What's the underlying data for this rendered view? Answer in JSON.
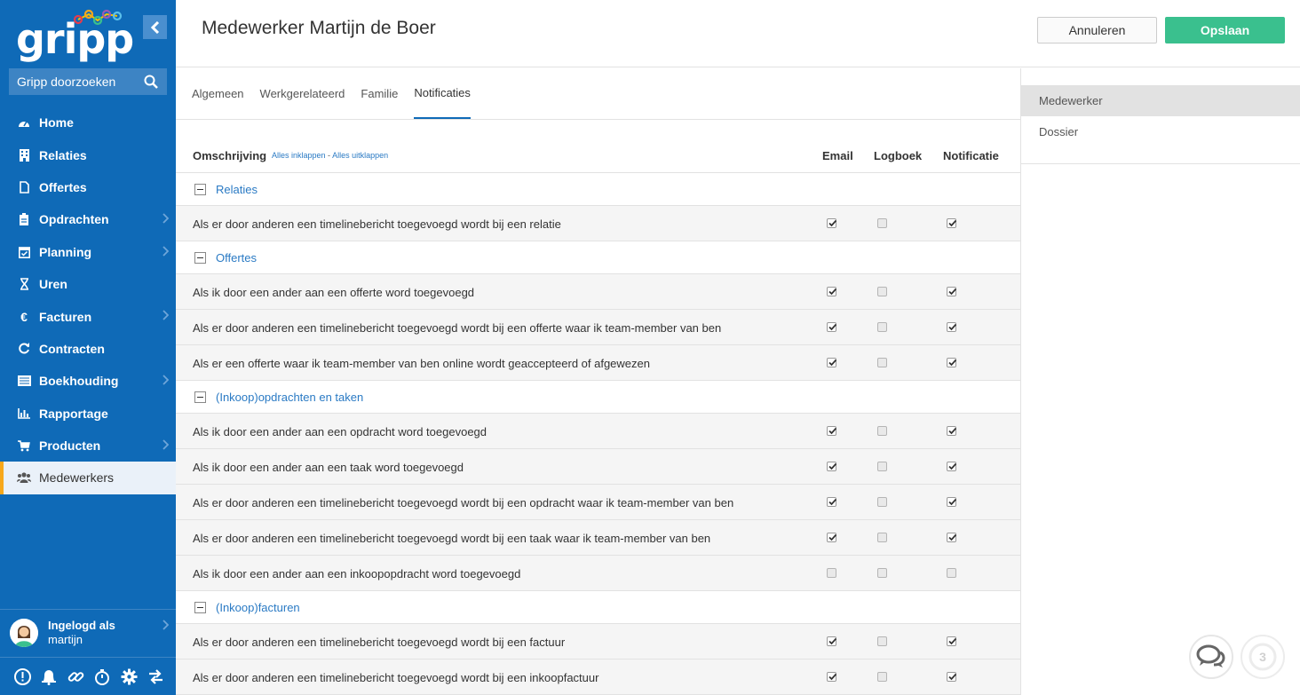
{
  "app": {
    "logo": "gripp"
  },
  "sidebar": {
    "search_placeholder": "Gripp doorzoeken",
    "items": [
      {
        "label": "Home",
        "icon": "dashboard-icon"
      },
      {
        "label": "Relaties",
        "icon": "building-icon"
      },
      {
        "label": "Offertes",
        "icon": "document-icon"
      },
      {
        "label": "Opdrachten",
        "icon": "clipboard-icon",
        "has_submenu": true
      },
      {
        "label": "Planning",
        "icon": "calendar-icon",
        "has_submenu": true
      },
      {
        "label": "Uren",
        "icon": "hourglass-icon"
      },
      {
        "label": "Facturen",
        "icon": "euro-icon",
        "has_submenu": true
      },
      {
        "label": "Contracten",
        "icon": "refresh-icon"
      },
      {
        "label": "Boekhouding",
        "icon": "ledger-icon",
        "has_submenu": true
      },
      {
        "label": "Rapportage",
        "icon": "bar-chart-icon"
      },
      {
        "label": "Producten",
        "icon": "cart-icon",
        "has_submenu": true
      },
      {
        "label": "Medewerkers",
        "icon": "users-icon",
        "active": true
      }
    ],
    "user": {
      "line1": "Ingelogd als",
      "line2": "martijn"
    },
    "bottom_icons": [
      "alert-icon",
      "bell-icon",
      "link-icon",
      "timer-icon",
      "gear-icon",
      "switch-icon"
    ]
  },
  "header": {
    "title": "Medewerker Martijn de Boer",
    "cancel_label": "Annuleren",
    "save_label": "Opslaan"
  },
  "tabs": [
    {
      "label": "Algemeen"
    },
    {
      "label": "Werkgerelateerd"
    },
    {
      "label": "Familie"
    },
    {
      "label": "Notificaties",
      "active": true
    }
  ],
  "right_panel": {
    "items": [
      {
        "label": "Medewerker",
        "active": true
      },
      {
        "label": "Dossier"
      }
    ]
  },
  "table": {
    "col_description": "Omschrijving",
    "collapse_all": "Alles inklappen",
    "separator": " - ",
    "expand_all": "Alles uitklappen",
    "col_email": "Email",
    "col_logbook": "Logboek",
    "col_notification": "Notificatie",
    "groups": [
      {
        "label": "Relaties",
        "rows": [
          {
            "label": "Als er door anderen een timelinebericht toegevoegd wordt bij een relatie",
            "email": true,
            "logbook": false,
            "notification": true
          }
        ]
      },
      {
        "label": "Offertes",
        "rows": [
          {
            "label": "Als ik door een ander aan een offerte word toegevoegd",
            "email": true,
            "logbook": false,
            "notification": true
          },
          {
            "label": "Als er door anderen een timelinebericht toegevoegd wordt bij een offerte waar ik team-member van ben",
            "email": true,
            "logbook": false,
            "notification": true
          },
          {
            "label": "Als er een offerte waar ik team-member van ben online wordt geaccepteerd of afgewezen",
            "email": true,
            "logbook": false,
            "notification": true
          }
        ]
      },
      {
        "label": "(Inkoop)opdrachten en taken",
        "rows": [
          {
            "label": "Als ik door een ander aan een opdracht word toegevoegd",
            "email": true,
            "logbook": false,
            "notification": true
          },
          {
            "label": "Als ik door een ander aan een taak word toegevoegd",
            "email": true,
            "logbook": false,
            "notification": true
          },
          {
            "label": "Als er door anderen een timelinebericht toegevoegd wordt bij een opdracht waar ik team-member van ben",
            "email": true,
            "logbook": false,
            "notification": true
          },
          {
            "label": "Als er door anderen een timelinebericht toegevoegd wordt bij een taak waar ik team-member van ben",
            "email": true,
            "logbook": false,
            "notification": true
          },
          {
            "label": "Als ik door een ander aan een inkoopopdracht word toegevoegd",
            "email": false,
            "logbook": false,
            "notification": false
          }
        ]
      },
      {
        "label": "(Inkoop)facturen",
        "rows": [
          {
            "label": "Als er door anderen een timelinebericht toegevoegd wordt bij een factuur",
            "email": true,
            "logbook": false,
            "notification": true
          },
          {
            "label": "Als er door anderen een timelinebericht toegevoegd wordt bij een inkoopfactuur",
            "email": true,
            "logbook": false,
            "notification": true
          }
        ]
      }
    ]
  },
  "floating": {
    "chat_icon": "chat-icon",
    "badge_count": "3"
  },
  "colors": {
    "sidebar": "#0f6ab7",
    "accent": "#3ac08e",
    "active_marker": "#f7a81b",
    "link": "#2a7ac4"
  }
}
